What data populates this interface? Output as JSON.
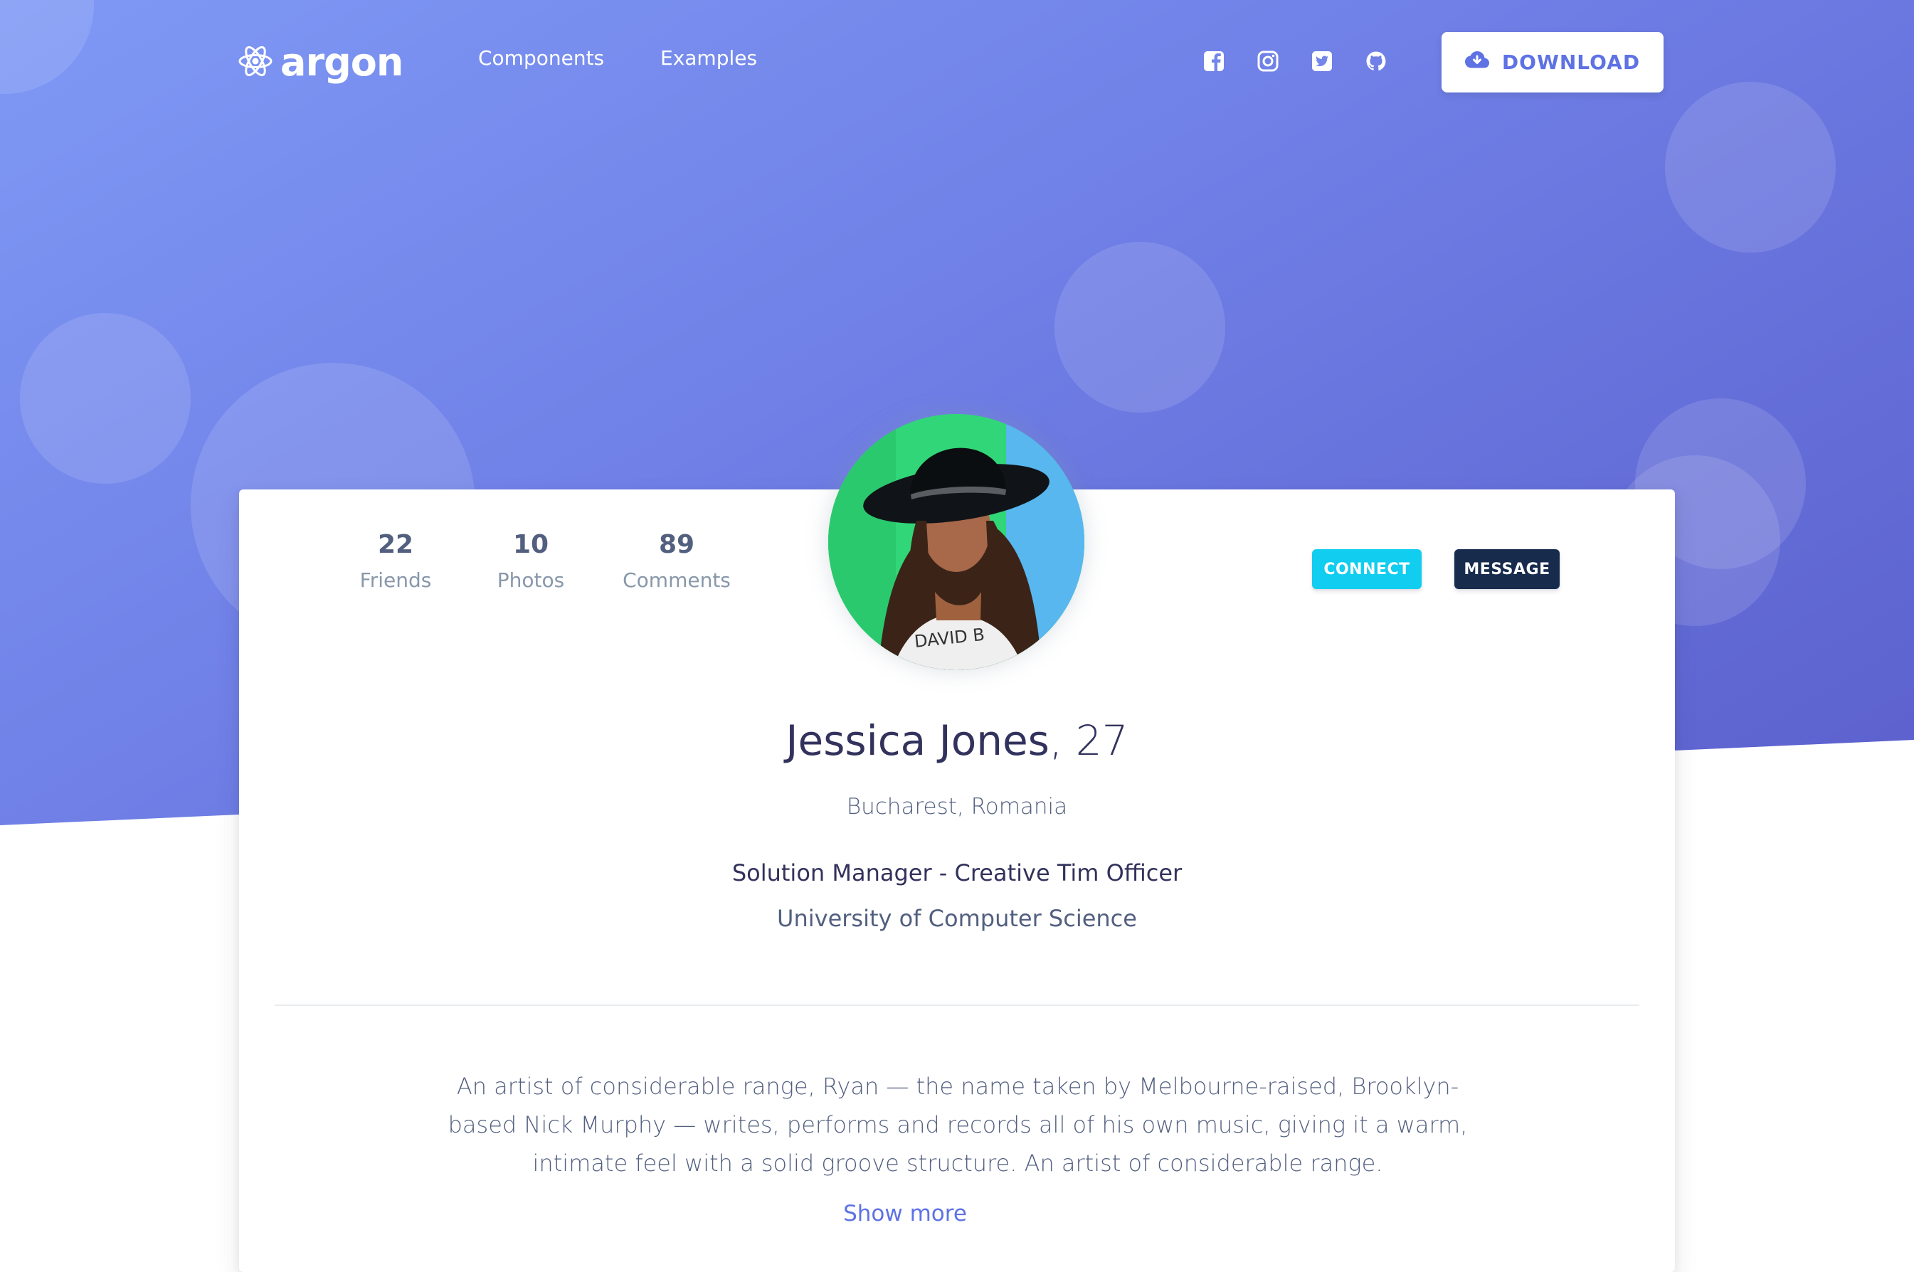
{
  "brand": {
    "name": "argon",
    "icon": "atom-icon"
  },
  "nav": {
    "links": [
      "Components",
      "Examples"
    ],
    "social": [
      {
        "icon": "facebook-icon"
      },
      {
        "icon": "instagram-icon"
      },
      {
        "icon": "twitter-icon"
      },
      {
        "icon": "github-icon"
      }
    ],
    "download_label": "DOWNLOAD"
  },
  "profile": {
    "stats": [
      {
        "value": "22",
        "label": "Friends"
      },
      {
        "value": "10",
        "label": "Photos"
      },
      {
        "value": "89",
        "label": "Comments"
      }
    ],
    "connect_label": "CONNECT",
    "message_label": "MESSAGE",
    "name": "Jessica Jones",
    "age": ", 27",
    "location": "Bucharest, Romania",
    "job": "Solution Manager - Creative Tim Officer",
    "education": "University of Computer Science",
    "bio": "An artist of considerable range, Ryan — the name taken by Melbourne-raised, Brooklyn-based Nick Murphy — writes, performs and records all of his own music, giving it a warm, intimate feel with a solid groove structure. An artist of considerable range.",
    "show_more": "Show more"
  },
  "colors": {
    "primary": "#5e72e4",
    "info": "#11cdef",
    "default": "#172b4d",
    "hero_start": "#7f99f5",
    "hero_end": "#5b5fcc"
  }
}
